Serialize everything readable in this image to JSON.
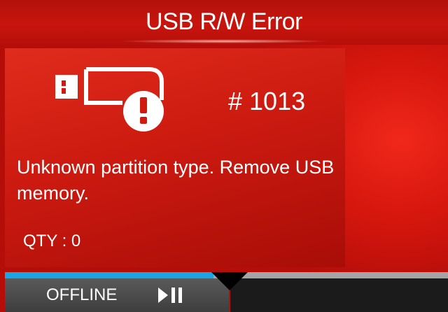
{
  "header": {
    "title": "USB R/W Error"
  },
  "error": {
    "code": "# 1013",
    "message": "Unknown partition type. Remove USB memory.",
    "icon": "usb-error-icon"
  },
  "counter": {
    "qty": "QTY : 0"
  },
  "status": {
    "label": "OFFLINE",
    "toggle_icon": "play-pause-icon"
  },
  "progress": {
    "value_fraction": 0.47
  },
  "colors": {
    "accent": "#19A6E3",
    "error_red": "#D41A10",
    "status_bar": "#4A4A4A"
  }
}
